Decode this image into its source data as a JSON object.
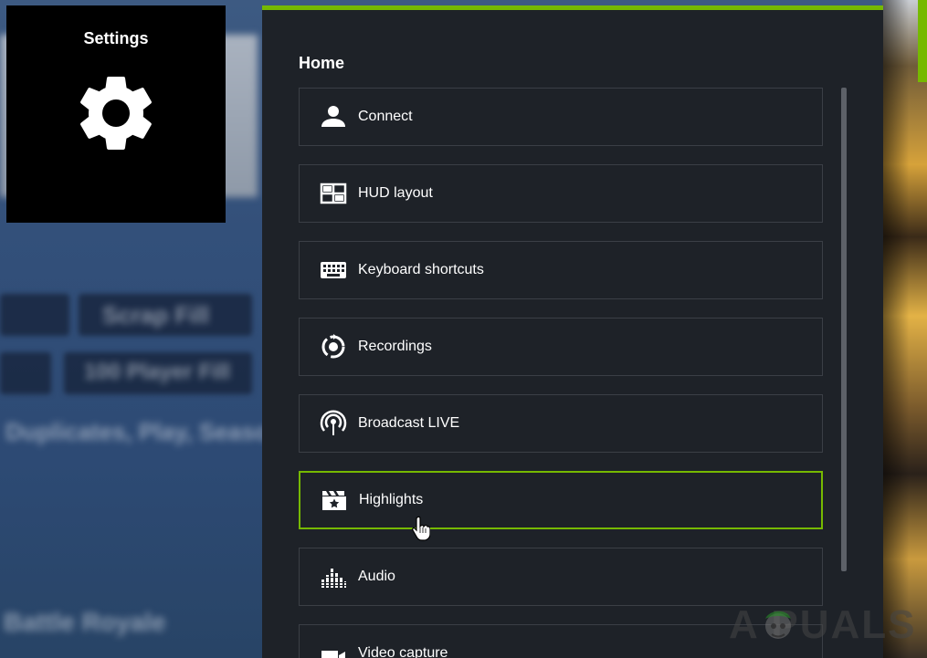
{
  "settings_tile": {
    "title": "Settings"
  },
  "panel": {
    "heading": "Home",
    "items": [
      {
        "label": "Connect",
        "icon": "person-icon"
      },
      {
        "label": "HUD layout",
        "icon": "hud-layout-icon"
      },
      {
        "label": "Keyboard shortcuts",
        "icon": "keyboard-icon"
      },
      {
        "label": "Recordings",
        "icon": "recordings-icon"
      },
      {
        "label": "Broadcast LIVE",
        "icon": "broadcast-icon"
      },
      {
        "label": "Highlights",
        "icon": "clapperboard-star-icon",
        "active": true
      },
      {
        "label": "Audio",
        "icon": "audio-equalizer-icon"
      },
      {
        "label": "Video capture",
        "icon": "video-camera-icon"
      }
    ]
  },
  "background": {
    "blurred_words": [
      "Scrap Fill",
      "100 Player Fill",
      "Duplicates, Play, Season",
      "Battle Royale"
    ]
  },
  "watermark": {
    "text": "A  PUALS"
  },
  "colors": {
    "accent": "#76b900",
    "panel_bg": "#1e2228",
    "item_border": "#3b3f46",
    "tile_bg": "#000000"
  }
}
